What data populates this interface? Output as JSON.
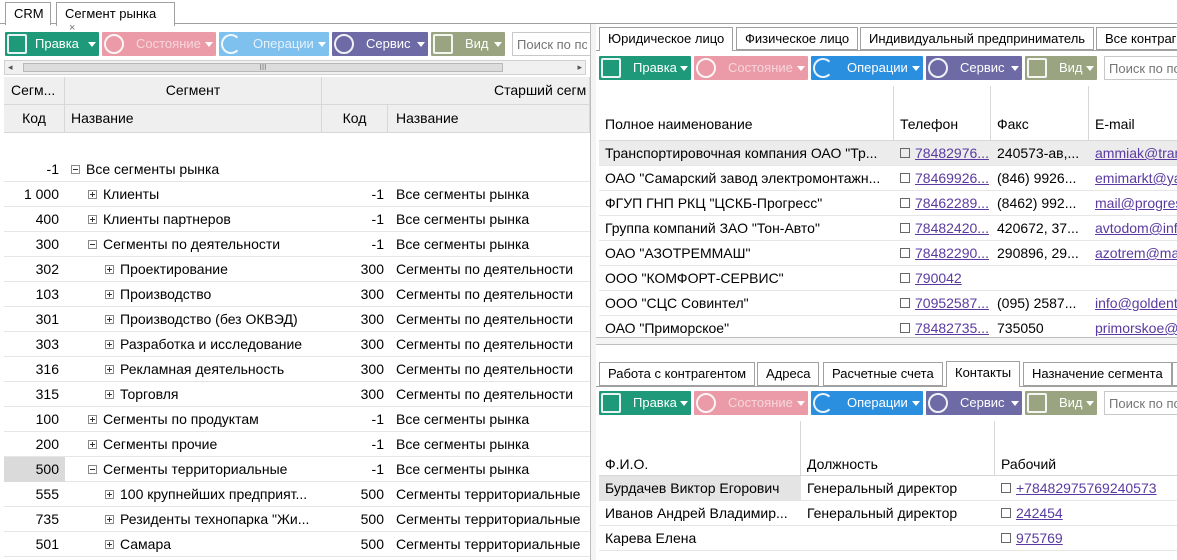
{
  "doc_tabs": [
    {
      "label": "CRM"
    },
    {
      "label": "Сегмент рынка"
    }
  ],
  "left": {
    "toolbar": {
      "edit": "Правка",
      "state": "Состояние",
      "ops": "Операции",
      "service": "Сервис",
      "view": "Вид",
      "search_placeholder": "Поиск по пол"
    },
    "hscroll_grip": "III",
    "group_headers": {
      "segment_short": "Сегм...",
      "segment": "Сегмент",
      "parent": "Старший сегм"
    },
    "columns": {
      "code": "Код",
      "name": "Название",
      "pcode": "Код",
      "pname": "Название"
    },
    "rows": [
      {
        "code": "-1",
        "name": "Все сегменты рынка",
        "pcode": "",
        "pname": ""
      },
      {
        "code": "1 000",
        "name": "Клиенты",
        "pcode": "-1",
        "pname": "Все сегменты рынка"
      },
      {
        "code": "400",
        "name": "Клиенты партнеров",
        "pcode": "-1",
        "pname": "Все сегменты рынка"
      },
      {
        "code": "300",
        "name": "Сегменты по деятельности",
        "pcode": "-1",
        "pname": "Все сегменты рынка"
      },
      {
        "code": "302",
        "name": "Проектирование",
        "pcode": "300",
        "pname": "Сегменты по деятельности"
      },
      {
        "code": "103",
        "name": "Производство",
        "pcode": "300",
        "pname": "Сегменты по деятельности"
      },
      {
        "code": "301",
        "name": "Производство (без ОКВЭД)",
        "pcode": "300",
        "pname": "Сегменты по деятельности"
      },
      {
        "code": "303",
        "name": "Разработка и исследование",
        "pcode": "300",
        "pname": "Сегменты по деятельности"
      },
      {
        "code": "316",
        "name": "Рекламная деятельность",
        "pcode": "300",
        "pname": "Сегменты по деятельности"
      },
      {
        "code": "315",
        "name": "Торговля",
        "pcode": "300",
        "pname": "Сегменты по деятельности"
      },
      {
        "code": "100",
        "name": "Сегменты по продуктам",
        "pcode": "-1",
        "pname": "Все сегменты рынка"
      },
      {
        "code": "200",
        "name": "Сегменты прочие",
        "pcode": "-1",
        "pname": "Все сегменты рынка"
      },
      {
        "code": "500",
        "name": "Сегменты территориальные",
        "pcode": "-1",
        "pname": "Все сегменты рынка"
      },
      {
        "code": "555",
        "name": "100 крупнейших предприят...",
        "pcode": "500",
        "pname": "Сегменты территориальные"
      },
      {
        "code": "735",
        "name": "Резиденты технопарка \"Жи...",
        "pcode": "500",
        "pname": "Сегменты территориальные"
      },
      {
        "code": "501",
        "name": "Самара",
        "pcode": "500",
        "pname": "Сегменты территориальные"
      }
    ]
  },
  "right": {
    "tabs": [
      "Юридическое лицо",
      "Физическое лицо",
      "Индивидуальный предприниматель",
      "Все контраг"
    ],
    "toolbar": {
      "edit": "Правка",
      "state": "Состояние",
      "ops": "Операции",
      "service": "Сервис",
      "view": "Вид",
      "search_placeholder": "Поиск по по"
    },
    "columns": {
      "name": "Полное наименование",
      "phone": "Телефон",
      "fax": "Факс",
      "email": "E-mail"
    },
    "rows": [
      {
        "name": "Транспортировочная компания ОАО \"Тр...",
        "phone": "78482976...",
        "fax": "240573-ав,...",
        "email": "ammiak@tran"
      },
      {
        "name": "ОАО \"Самарский завод электромонтажн...",
        "phone": "78469926...",
        "fax": "(846) 9926...",
        "email": "emimarkt@ya"
      },
      {
        "name": "ФГУП ГНП РКЦ \"ЦСКБ-Прогресс\"",
        "phone": "78462289...",
        "fax": "(8462) 992...",
        "email": "mail@progres"
      },
      {
        "name": "Группа компаний ЗАО \"Тон-Авто\"",
        "phone": "78482420...",
        "fax": "420672, 37...",
        "email": "avtodom@info"
      },
      {
        "name": "ОАО \"АЗОТРЕММАШ\"",
        "phone": "78482290...",
        "fax": "290896, 29...",
        "email": "azotrem@mai"
      },
      {
        "name": "ООО \"КОМФОРТ-СЕРВИС\"",
        "phone": "790042",
        "fax": "",
        "email": ""
      },
      {
        "name": "ООО \"СЦС Совинтел\"",
        "phone": "70952587...",
        "fax": "(095) 2587...",
        "email": "info@goldente"
      },
      {
        "name": "ОАО \"Приморское\"",
        "phone": "78482735...",
        "fax": "735050",
        "email": "primorskoe@v"
      }
    ],
    "subtabs": [
      "Работа с контрагентом",
      "Адреса",
      "Расчетные счета",
      "Контакты",
      "Назначение сегмента"
    ],
    "toolbar2": {
      "edit": "Правка",
      "state": "Состояние",
      "ops": "Операции",
      "service": "Сервис",
      "view": "Вид",
      "search_placeholder": "Поиск по по"
    },
    "contact_columns": {
      "fio": "Ф.И.О.",
      "position": "Должность",
      "work": "Рабочий"
    },
    "contacts": [
      {
        "fio": "Бурдачев Виктор Егорович",
        "position": "Генеральный директор",
        "work": "+78482975769240573"
      },
      {
        "fio": "Иванов Андрей Владимир...",
        "position": "Генеральный директор",
        "work": "242454"
      },
      {
        "fio": "Карева Елена",
        "position": "",
        "work": "975769"
      }
    ]
  }
}
